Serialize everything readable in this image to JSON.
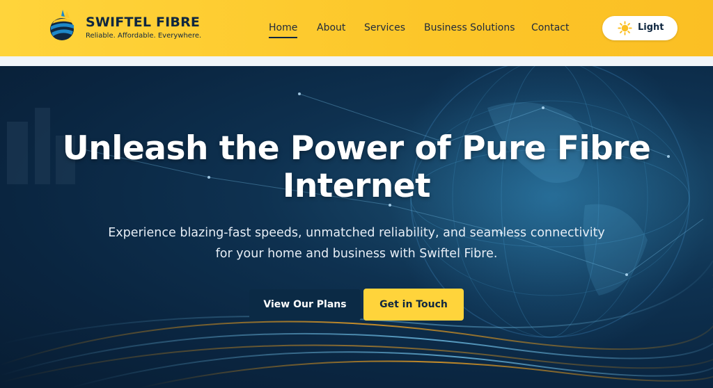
{
  "brand": {
    "name": "SWIFTEL FIBRE",
    "tagline": "Reliable. Affordable. Everywhere."
  },
  "nav": {
    "items": [
      {
        "label": "Home",
        "active": true
      },
      {
        "label": "About",
        "active": false
      },
      {
        "label": "Services",
        "active": false
      },
      {
        "label": "Business Solutions",
        "active": false
      },
      {
        "label": "Contact",
        "active": false
      }
    ]
  },
  "theme_toggle": {
    "label": "Light",
    "icon": "sun-icon"
  },
  "hero": {
    "title": "Unleash the Power of Pure Fibre Internet",
    "subtitle": "Experience blazing-fast speeds, unmatched reliability, and seamless connectivity for your home and business with Swiftel Fibre.",
    "primary_button": "View Our Plans",
    "secondary_button": "Get in Touch"
  },
  "colors": {
    "header_yellow": "#fcc629",
    "navy": "#0f2740",
    "accent_yellow": "#ffd43b",
    "hero_blue": "#0e3150"
  }
}
